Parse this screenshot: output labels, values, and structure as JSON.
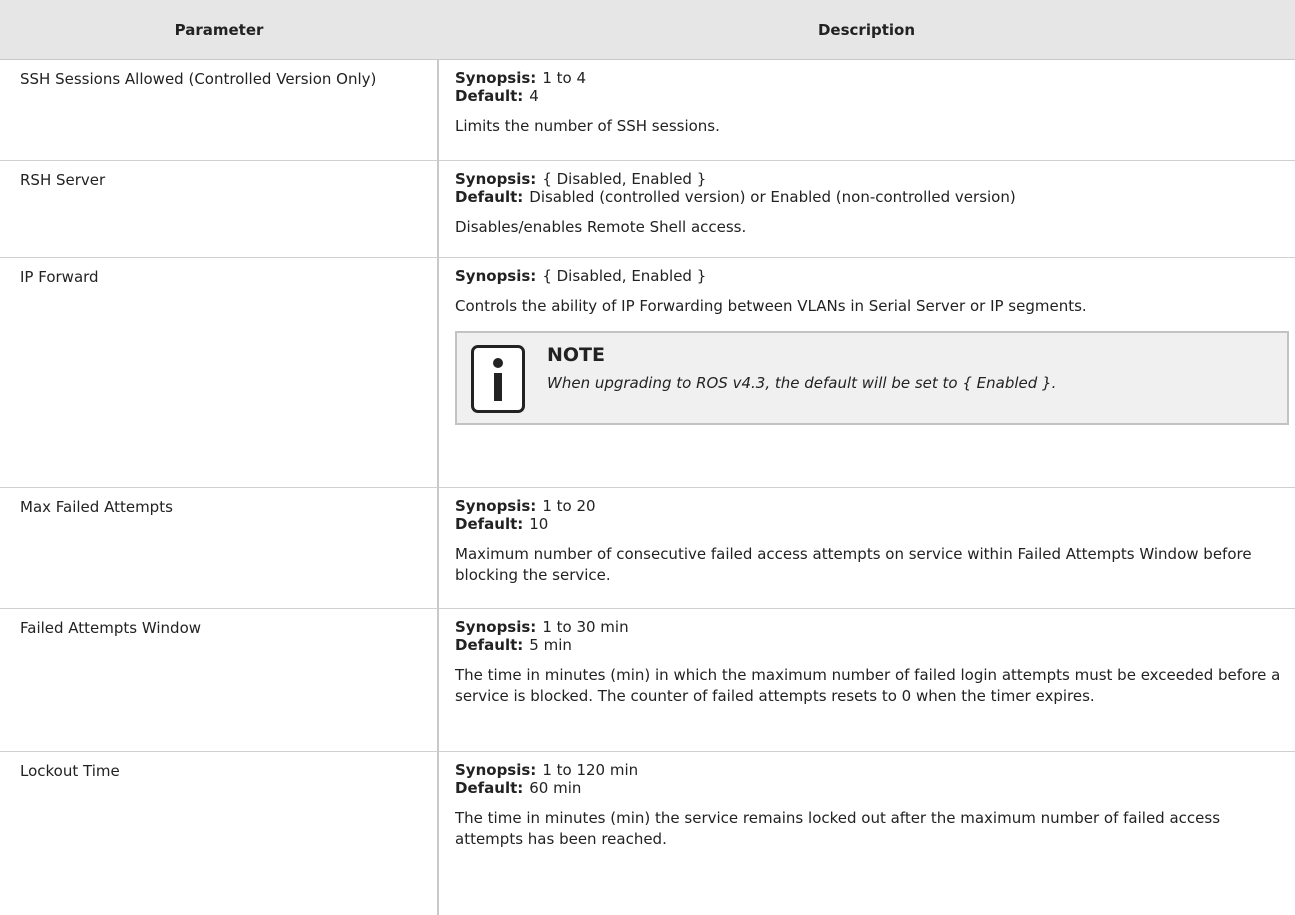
{
  "table": {
    "headers": {
      "parameter": "Parameter",
      "description": "Description"
    },
    "labels": {
      "synopsis": "Synopsis:",
      "default": "Default:"
    },
    "rows": [
      {
        "parameter": "SSH Sessions Allowed (Controlled Version Only)",
        "synopsis": "1 to 4",
        "default": "4",
        "text": "Limits the number of SSH sessions."
      },
      {
        "parameter": "RSH Server",
        "synopsis": "{ Disabled, Enabled }",
        "default": "Disabled (controlled version) or Enabled (non-controlled version)",
        "text": "Disables/enables Remote Shell access."
      },
      {
        "parameter": "IP Forward",
        "synopsis": "{ Disabled, Enabled }",
        "text": "Controls the ability of IP Forwarding between VLANs in Serial Server or IP segments.",
        "note": {
          "title": "NOTE",
          "text": "When upgrading to ROS v4.3, the default will be set to { Enabled }."
        }
      },
      {
        "parameter": "Max Failed Attempts",
        "synopsis": "1 to 20",
        "default": "10",
        "text": "Maximum number of consecutive failed access attempts on service within Failed Attempts Window before blocking the service."
      },
      {
        "parameter": "Failed Attempts Window",
        "synopsis": "1 to 30 min",
        "default": "5 min",
        "text": "The time in minutes (min) in which the maximum number of failed login attempts must be exceeded before a service is blocked. The counter of failed attempts resets to 0 when the timer expires."
      },
      {
        "parameter": "Lockout Time",
        "synopsis": "1 to 120 min",
        "default": "60 min",
        "text": "The time in minutes (min) the service remains locked out after the maximum number of failed access attempts has been reached."
      }
    ]
  }
}
